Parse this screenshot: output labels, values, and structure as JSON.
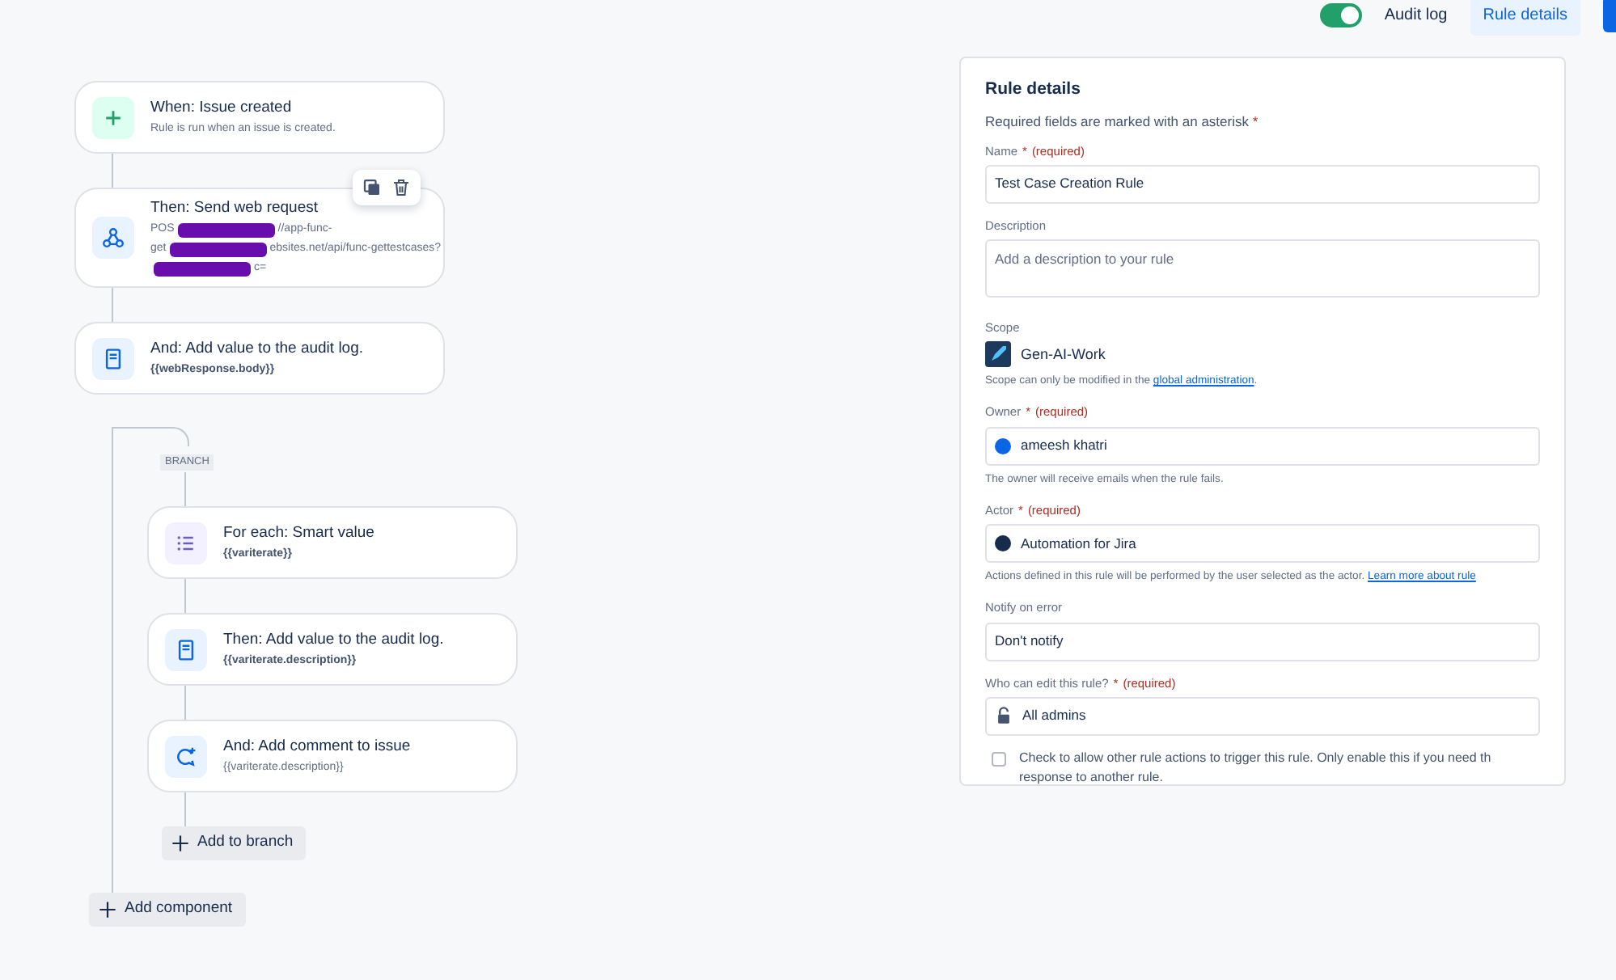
{
  "header": {
    "audit_log": {
      "label": "Audit log",
      "on": true
    },
    "tabs": [
      {
        "label": "Rule details",
        "selected": true
      }
    ]
  },
  "flow": {
    "components": [
      {
        "kind": "trigger",
        "title": "When: Issue created",
        "detail": "Rule is run when an issue is created.",
        "detail_bold": false
      },
      {
        "kind": "web-request",
        "title": "Then: Send web request",
        "hovered": true,
        "detail_lines": [
          [
            {
              "kind": "text",
              "text": "POS"
            },
            {
              "kind": "redaction"
            },
            {
              "kind": "text",
              "text": "//app-func-"
            }
          ],
          [
            {
              "kind": "text",
              "text": "get"
            },
            {
              "kind": "redaction"
            },
            {
              "kind": "text",
              "text": "ebsites.net/api/func-gettestcases?"
            }
          ],
          [
            {
              "kind": "redaction"
            },
            {
              "kind": "text",
              "text": "c="
            }
          ]
        ]
      },
      {
        "kind": "audit-log",
        "title": "And: Add value to the audit log.",
        "detail": "{{webResponse.body}}",
        "detail_bold": true
      }
    ],
    "branch": {
      "label": "BRANCH",
      "components": [
        {
          "kind": "for-each",
          "title": "For each: Smart value",
          "detail": "{{variterate}}",
          "detail_bold": true
        },
        {
          "kind": "audit-log",
          "title": "Then: Add value to the audit log.",
          "detail": "{{variterate.description}}",
          "detail_bold": true
        },
        {
          "kind": "comment",
          "title": "And: Add comment to issue",
          "detail": "{{variterate.description}}",
          "detail_bold": false
        }
      ],
      "add_button": "Add to branch"
    },
    "add_button": "Add component"
  },
  "rule_details": {
    "title": "Rule details",
    "required_note": "Required fields are marked with an asterisk",
    "required_mark": "*",
    "fields": [
      {
        "kind": "text",
        "label": "Name",
        "asterisk": "*",
        "required": "(required)",
        "value": "Test Case Creation Rule"
      },
      {
        "kind": "textarea",
        "label": "Description",
        "placeholder": "Add a description to your rule"
      },
      {
        "kind": "scope",
        "label": "Scope",
        "value": "Gen-AI-Work",
        "help": {
          "text": "Scope can only be modified in the",
          "link": "global administration",
          "after": "."
        }
      },
      {
        "kind": "user",
        "label": "Owner",
        "asterisk": "*",
        "required": "(required)",
        "value": "ameesh khatri",
        "avatar": {
          "kind": "person"
        },
        "help": {
          "text": "The owner will receive emails when the rule fails."
        }
      },
      {
        "kind": "user",
        "label": "Actor",
        "asterisk": "*",
        "required": "(required)",
        "value": "Automation for Jira",
        "avatar": {
          "kind": "app"
        },
        "help": {
          "text": "Actions defined in this rule will be performed by the user selected as the actor.",
          "link": "Learn more about rule"
        }
      },
      {
        "kind": "select",
        "label": "Notify on error",
        "value": "Don't notify"
      },
      {
        "kind": "lock",
        "label": "Who can edit this rule?",
        "asterisk": "*",
        "required": "(required)",
        "value": "All admins"
      },
      {
        "kind": "checkbox",
        "checked": false,
        "lines": [
          "Check to allow other rule actions to trigger this rule. Only enable this if you need th",
          "response to another rule."
        ]
      }
    ]
  }
}
